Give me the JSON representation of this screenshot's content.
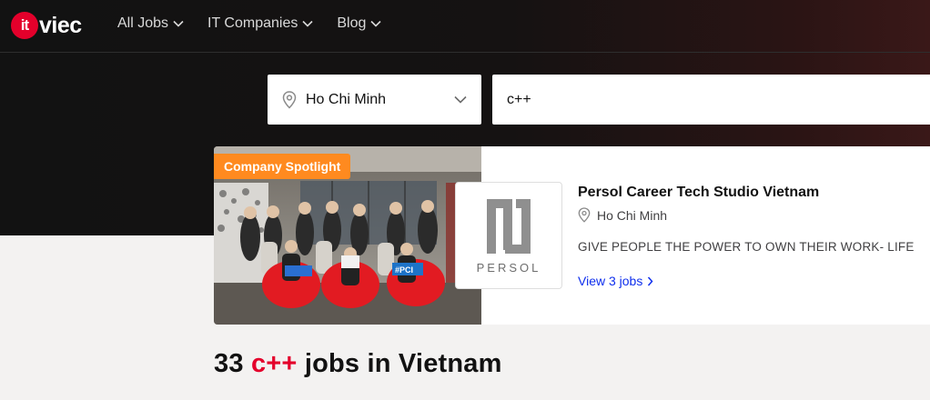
{
  "brand": {
    "logo_mark": "it",
    "logo_word": "viec",
    "color": "#e4002b"
  },
  "nav": [
    {
      "label": "All Jobs"
    },
    {
      "label": "IT Companies"
    },
    {
      "label": "Blog"
    }
  ],
  "search": {
    "city": {
      "value": "Ho Chi Minh",
      "icon": "location-pin-icon"
    },
    "keyword": {
      "value": "c++"
    }
  },
  "spotlight": {
    "badge": "Company Spotlight",
    "logo_word": "PERSOL",
    "company_name": "Persol Career Tech Studio Vietnam",
    "location": "Ho Chi Minh",
    "tagline": "GIVE PEOPLE THE POWER TO OWN THEIR WORK- LIFE",
    "view_jobs": "View 3 jobs",
    "photo_signs": [
      "#PCI"
    ],
    "colors": {
      "badge": "#ff8a1f",
      "link": "#0e2eed"
    }
  },
  "results": {
    "count": "33",
    "keyword": "c++",
    "suffix": "jobs in Vietnam"
  }
}
